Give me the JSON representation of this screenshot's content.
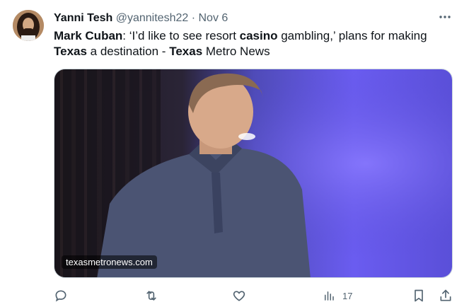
{
  "tweet": {
    "display_name": "Yanni Tesh",
    "handle": "@yannitesh22",
    "separator": "·",
    "date": "Nov 6",
    "text_parts": [
      {
        "text": "Mark Cuban",
        "bold": true
      },
      {
        "text": ": ‘I’d like to see resort ",
        "bold": false
      },
      {
        "text": "casino",
        "bold": true
      },
      {
        "text": " gambling,’ plans for making ",
        "bold": false
      },
      {
        "text": "Texas",
        "bold": true
      },
      {
        "text": " a destination - ",
        "bold": false
      },
      {
        "text": "Texas",
        "bold": true
      },
      {
        "text": " Metro News",
        "bold": false
      }
    ],
    "card_domain": "texasmetronews.com",
    "views": "17"
  },
  "icons": {
    "more": "more-dots-icon",
    "reply": "reply-icon",
    "retweet": "retweet-icon",
    "like": "heart-icon",
    "views": "views-chart-icon",
    "bookmark": "bookmark-icon",
    "share": "share-icon"
  },
  "colors": {
    "text": "#0f1419",
    "muted": "#536471",
    "border": "#cfd9de"
  }
}
